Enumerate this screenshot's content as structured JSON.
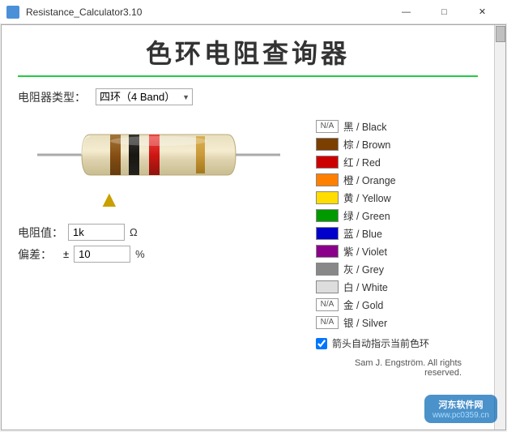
{
  "titlebar": {
    "title": "Resistance_Calculator3.10",
    "minimize": "—",
    "maximize": "□",
    "close": "✕"
  },
  "app": {
    "title": "色环电阻查询器",
    "divider_color": "#22cc44"
  },
  "type_selector": {
    "label": "电阻器类型：",
    "selected": "四环（4 Band）"
  },
  "result": {
    "resistance_label": "电阻值：",
    "resistance_value": "1k",
    "resistance_unit": "Ω",
    "tolerance_label": "偏差：",
    "tolerance_pm": "±",
    "tolerance_value": "10",
    "tolerance_unit": "%"
  },
  "checkbox": {
    "label": "箭头自动指示当前色环",
    "checked": true
  },
  "footer": {
    "text": "Sam J. Engström. All rights reserved."
  },
  "colors": [
    {
      "id": "black",
      "swatch_type": "na",
      "na_text": "N/A",
      "bg": "#ffffff",
      "label": "黑 / Black"
    },
    {
      "id": "brown",
      "swatch_type": "color",
      "bg": "#7B3F00",
      "label": "棕 / Brown"
    },
    {
      "id": "red",
      "swatch_type": "color",
      "bg": "#CC0000",
      "label": "红 / Red"
    },
    {
      "id": "orange",
      "swatch_type": "color",
      "bg": "#FF8000",
      "label": "橙 / Orange"
    },
    {
      "id": "yellow",
      "swatch_type": "color",
      "bg": "#FFDD00",
      "label": "黄 / Yellow"
    },
    {
      "id": "green",
      "swatch_type": "color",
      "bg": "#009900",
      "label": "绿 / Green"
    },
    {
      "id": "blue",
      "swatch_type": "color",
      "bg": "#0000CC",
      "label": "蓝 / Blue"
    },
    {
      "id": "violet",
      "swatch_type": "color",
      "bg": "#8B008B",
      "label": "紫 / Violet"
    },
    {
      "id": "grey",
      "swatch_type": "color",
      "bg": "#888888",
      "label": "灰 / Grey"
    },
    {
      "id": "white",
      "swatch_type": "color",
      "bg": "#dddddd",
      "label": "白 / White"
    },
    {
      "id": "gold",
      "swatch_type": "na",
      "na_text": "N/A",
      "bg": "#ffffff",
      "label": "金 / Gold"
    },
    {
      "id": "silver",
      "swatch_type": "na",
      "na_text": "N/A",
      "bg": "#ffffff",
      "label": "银 / Silver"
    }
  ],
  "watermark": {
    "line1": "河东软件网",
    "line2": "www.pc0359.cn"
  }
}
